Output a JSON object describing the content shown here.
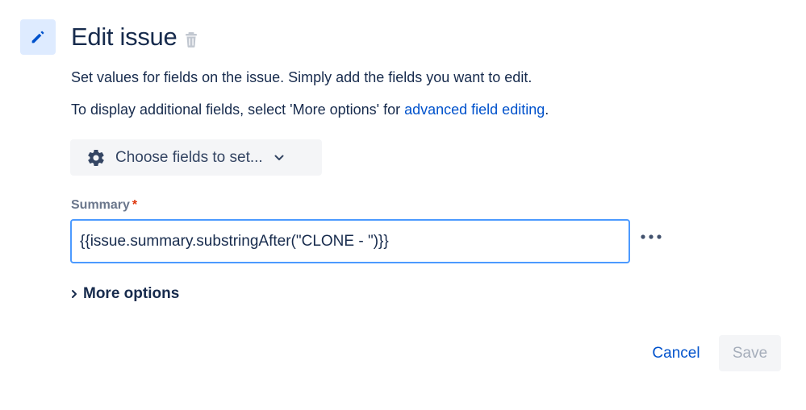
{
  "header": {
    "title": "Edit issue",
    "edit_icon": "pencil-icon",
    "delete_icon": "trash-icon"
  },
  "description": {
    "line1": "Set values for fields on the issue. Simply add the fields you want to edit.",
    "line2_prefix": "To display additional fields, select 'More options' for ",
    "line2_link": "advanced field editing",
    "line2_suffix": "."
  },
  "choose_fields": {
    "label": "Choose fields to set...",
    "icon": "gear-icon",
    "dropdown_icon": "chevron-down-icon"
  },
  "summary_field": {
    "label": "Summary",
    "required_marker": "*",
    "value": "{{issue.summary.substringAfter(\"CLONE - \")}}",
    "more_icon": "more-horizontal-icon"
  },
  "more_options": {
    "label": "More options",
    "icon": "chevron-right-icon"
  },
  "footer": {
    "cancel_label": "Cancel",
    "save_label": "Save"
  },
  "colors": {
    "link": "#0052cc",
    "icon_bg": "#deebff",
    "required": "#de350b",
    "focus_border": "#4c9aff",
    "disabled_text": "#a5adba"
  }
}
